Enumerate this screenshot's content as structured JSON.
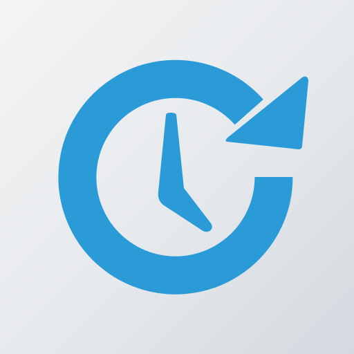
{
  "icon": {
    "name": "history-clock-icon",
    "colors": {
      "accent": "#2b9bd8",
      "background_light": "#f3f4f5",
      "background_dark": "#d3d9df"
    }
  }
}
